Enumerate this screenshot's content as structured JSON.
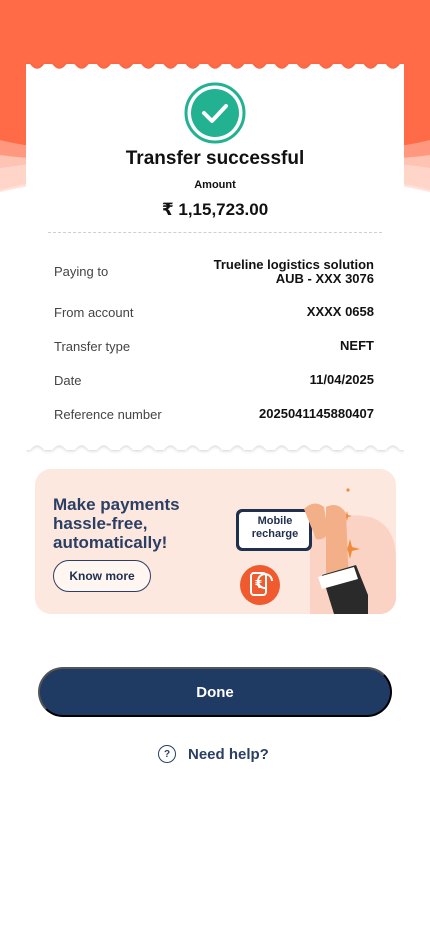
{
  "receipt": {
    "title": "Transfer successful",
    "amount_label": "Amount",
    "amount_value": "₹ 1,15,723.00",
    "rows": [
      {
        "label": "Paying to",
        "value_line1": "Trueline logistics solution",
        "value_line2": "AUB - XXX 3076"
      },
      {
        "label": "From account",
        "value": "XXXX 0658"
      },
      {
        "label": "Transfer type",
        "value": "NEFT"
      },
      {
        "label": "Date",
        "value": "11/04/2025"
      },
      {
        "label": "Reference number",
        "value": "2025041145880407"
      }
    ]
  },
  "promo": {
    "title_line1": "Make payments",
    "title_line2": "hassle-free,",
    "title_line3": "automatically!",
    "cta": "Know more",
    "phone_line1": "Mobile",
    "phone_line2": "recharge",
    "icon": "rupee-refresh-icon"
  },
  "actions": {
    "done": "Done",
    "help": "Need help?",
    "help_icon": "?"
  },
  "colors": {
    "header_orange": "#ff6a47",
    "success_teal": "#22b191",
    "primary_navy": "#1f3a63",
    "promo_bg": "#fde8e0"
  }
}
